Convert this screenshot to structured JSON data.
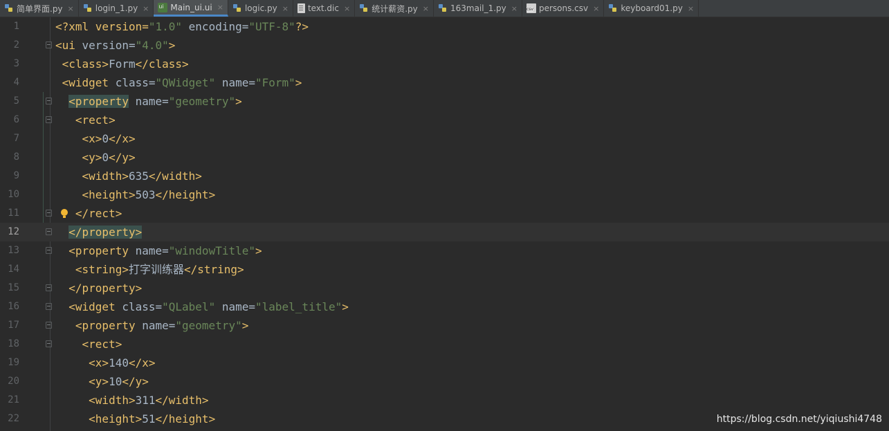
{
  "tabs": [
    {
      "label": "简单界面.py",
      "icon": "python-file-icon",
      "active": false
    },
    {
      "label": "login_1.py",
      "icon": "python-file-icon",
      "active": false
    },
    {
      "label": "Main_ui.ui",
      "icon": "ui-file-icon",
      "active": true
    },
    {
      "label": "logic.py",
      "icon": "python-file-icon",
      "active": false
    },
    {
      "label": "text.dic",
      "icon": "text-file-icon",
      "active": false
    },
    {
      "label": "统计薪资.py",
      "icon": "python-file-icon",
      "active": false
    },
    {
      "label": "163mail_1.py",
      "icon": "python-file-icon",
      "active": false
    },
    {
      "label": "persons.csv",
      "icon": "csv-file-icon",
      "active": false
    },
    {
      "label": "keyboard01.py",
      "icon": "python-file-icon",
      "active": false
    }
  ],
  "tab_close_glyph": "×",
  "current_line": 12,
  "lines": [
    {
      "n": "1",
      "t": [
        "<?xml version=",
        "\"1.0\"",
        " encoding=",
        "\"UTF-8\"",
        "?>"
      ]
    },
    {
      "n": "2",
      "t": [
        "<ui",
        " version=",
        "\"4.0\"",
        ">"
      ]
    },
    {
      "n": "3",
      "t": [
        " <class>",
        "Form",
        "</class>"
      ]
    },
    {
      "n": "4",
      "t": [
        " <widget",
        " class=",
        "\"QWidget\"",
        " name=",
        "\"Form\"",
        ">"
      ]
    },
    {
      "n": "5",
      "t": [
        "  <property",
        " name=",
        "\"geometry\"",
        ">"
      ]
    },
    {
      "n": "6",
      "t": [
        "   <rect>"
      ]
    },
    {
      "n": "7",
      "t": [
        "    <x>",
        "0",
        "</x>"
      ]
    },
    {
      "n": "8",
      "t": [
        "    <y>",
        "0",
        "</y>"
      ]
    },
    {
      "n": "9",
      "t": [
        "    <width>",
        "635",
        "</width>"
      ]
    },
    {
      "n": "10",
      "t": [
        "    <height>",
        "503",
        "</height>"
      ]
    },
    {
      "n": "11",
      "t": [
        "   </rect>"
      ]
    },
    {
      "n": "12",
      "t": [
        "  </property>"
      ]
    },
    {
      "n": "13",
      "t": [
        "  <property",
        " name=",
        "\"windowTitle\"",
        ">"
      ]
    },
    {
      "n": "14",
      "t": [
        "   <string>",
        "打字训练器",
        "</string>"
      ]
    },
    {
      "n": "15",
      "t": [
        "  </property>"
      ]
    },
    {
      "n": "16",
      "t": [
        "  <widget",
        " class=",
        "\"QLabel\"",
        " name=",
        "\"label_title\"",
        ">"
      ]
    },
    {
      "n": "17",
      "t": [
        "   <property",
        " name=",
        "\"geometry\"",
        ">"
      ]
    },
    {
      "n": "18",
      "t": [
        "    <rect>"
      ]
    },
    {
      "n": "19",
      "t": [
        "     <x>",
        "140",
        "</x>"
      ]
    },
    {
      "n": "20",
      "t": [
        "     <y>",
        "10",
        "</y>"
      ]
    },
    {
      "n": "21",
      "t": [
        "     <width>",
        "311",
        "</width>"
      ]
    },
    {
      "n": "22",
      "t": [
        "     <height>",
        "51",
        "</height>"
      ]
    }
  ],
  "colors": {
    "background": "#2b2b2b",
    "tag": "#e8bf6a",
    "attr_value": "#6a8759",
    "text": "#a9b7c6",
    "current_line": "#323232",
    "tag_match_highlight": "#3b514d"
  },
  "watermark": "https://blog.csdn.net/yiqiushi4748"
}
